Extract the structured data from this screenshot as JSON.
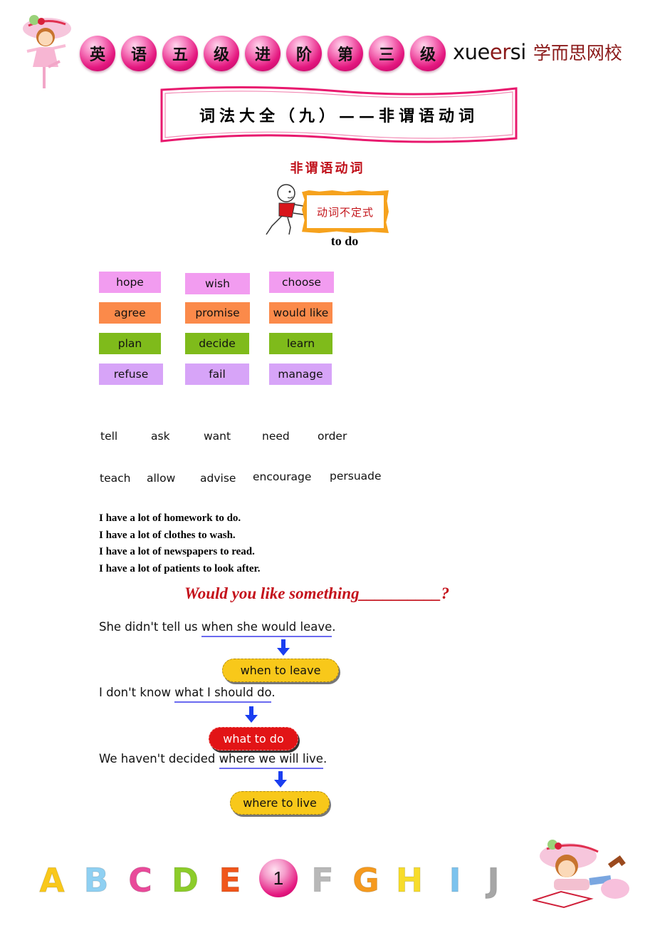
{
  "header": {
    "title_chars": [
      "英",
      "语",
      "五",
      "级",
      "进",
      "阶",
      "第",
      "三",
      "级"
    ],
    "brand_en": [
      "xue",
      "er",
      "si"
    ],
    "brand_cn": "学而思网校",
    "colors": {
      "ball": "#e4177f",
      "brand_red": "#8b1a1a"
    }
  },
  "banner": {
    "title": "词法大全（九）——非谓语动词",
    "border_color": "#e8196e"
  },
  "section": {
    "heading": "非谓语动词",
    "sign_label": "动词不定式",
    "form": "to do"
  },
  "verb_grid": {
    "rows": [
      {
        "color": "pink",
        "words": [
          "hope",
          "wish",
          "choose"
        ]
      },
      {
        "color": "orange",
        "words": [
          "agree",
          "promise",
          "would like"
        ]
      },
      {
        "color": "green",
        "words": [
          "plan",
          "decide",
          "learn"
        ]
      },
      {
        "color": "violet",
        "words": [
          "refuse",
          "fail",
          "manage"
        ]
      }
    ],
    "colors": {
      "pink": "#f29cf0",
      "orange": "#fb8a4a",
      "green": "#7fbb1b",
      "violet": "#d7a4f8"
    }
  },
  "object_verbs": {
    "row1": [
      "tell",
      "ask",
      "want",
      "need",
      "order"
    ],
    "row2": [
      "teach",
      "allow",
      "advise",
      "encourage",
      "persuade"
    ]
  },
  "sentences": [
    "I have a lot of homework to do.",
    "I have a lot of clothes to wash.",
    "I have a lot of newspapers to read.",
    "I have a lot of patients to look after."
  ],
  "question": "Would you like something__________?",
  "examples": [
    {
      "prefix": "She didn't tell us ",
      "clause": "when she would leave",
      "suffix": ".",
      "result": "when to leave",
      "pill_color": "yellow"
    },
    {
      "prefix": "I don't know ",
      "clause": "what I should do",
      "suffix": ".",
      "result": "what to do",
      "pill_color": "red"
    },
    {
      "prefix": "We haven't decided ",
      "clause": "where we will live",
      "suffix": ".",
      "result": "where to live",
      "pill_color": "yellow"
    }
  ],
  "footer": {
    "letters": [
      {
        "ch": "A",
        "color": "#f9c81a"
      },
      {
        "ch": "B",
        "color": "#8fd0f2"
      },
      {
        "ch": "C",
        "color": "#e94a9a"
      },
      {
        "ch": "D",
        "color": "#8ccc2a"
      },
      {
        "ch": "E",
        "color": "#f0561b"
      },
      {
        "ch": "F",
        "color": "#b8b8b8"
      },
      {
        "ch": "G",
        "color": "#f59a1e"
      },
      {
        "ch": "H",
        "color": "#f7dc2a"
      },
      {
        "ch": "I",
        "color": "#7cc3ee"
      },
      {
        "ch": "J",
        "color": "#a6a6a6"
      }
    ],
    "page_number": "1"
  }
}
